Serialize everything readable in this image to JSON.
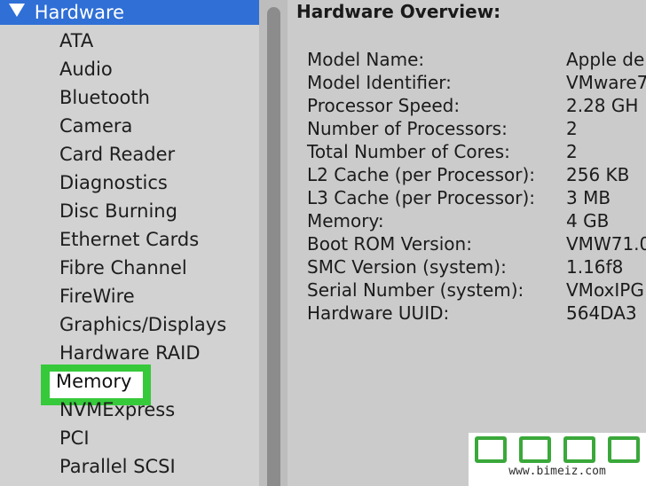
{
  "sidebar": {
    "header": "Hardware",
    "items": [
      {
        "label": "ATA"
      },
      {
        "label": "Audio"
      },
      {
        "label": "Bluetooth"
      },
      {
        "label": "Camera"
      },
      {
        "label": "Card Reader"
      },
      {
        "label": "Diagnostics"
      },
      {
        "label": "Disc Burning"
      },
      {
        "label": "Ethernet Cards"
      },
      {
        "label": "Fibre Channel"
      },
      {
        "label": "FireWire"
      },
      {
        "label": "Graphics/Displays"
      },
      {
        "label": "Hardware RAID"
      },
      {
        "label": "Memory",
        "highlighted": true
      },
      {
        "label": "NVMExpress"
      },
      {
        "label": "PCI"
      },
      {
        "label": "Parallel SCSI"
      }
    ]
  },
  "overview": {
    "title": "Hardware Overview:",
    "rows": [
      {
        "key": "Model Name:",
        "value": "Apple de"
      },
      {
        "key": "Model Identifier:",
        "value": "VMware7"
      },
      {
        "key": "Processor Speed:",
        "value": "2.28 GH"
      },
      {
        "key": "Number of Processors:",
        "value": "2"
      },
      {
        "key": "Total Number of Cores:",
        "value": "2"
      },
      {
        "key": "L2 Cache (per Processor):",
        "value": "256 KB"
      },
      {
        "key": "L3 Cache (per Processor):",
        "value": "3 MB"
      },
      {
        "key": "Memory:",
        "value": "4 GB"
      },
      {
        "key": "Boot ROM Version:",
        "value": "VMW71.0"
      },
      {
        "key": "SMC Version (system):",
        "value": "1.16f8"
      },
      {
        "key": "Serial Number (system):",
        "value": "VMoxIPG"
      },
      {
        "key": "Hardware UUID:",
        "value": "564DA3"
      }
    ]
  },
  "watermark": {
    "url": "www.bimeiz.com"
  },
  "colors": {
    "selection_blue": "#2f6fd6",
    "highlight_green": "#36c93a"
  }
}
